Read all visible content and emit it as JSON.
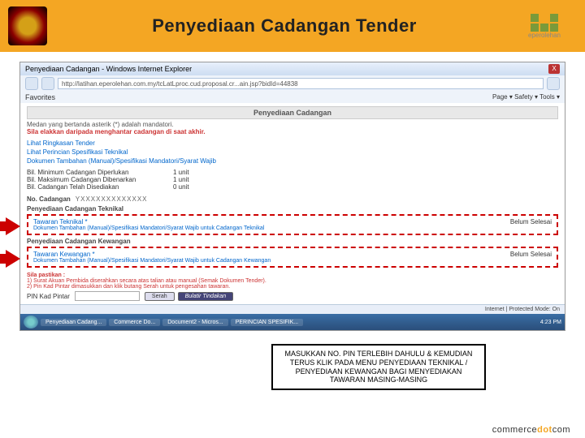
{
  "slide": {
    "title": "Penyediaan Cadangan Tender"
  },
  "logo_right_text": "eperolehan",
  "browser": {
    "window_title": "Penyediaan Cadangan - Windows Internet Explorer",
    "url": "http://latihan.eperolehan.com.my/tcLatLproc.cud.proposal.cr...ain.jsp?bidId=44838",
    "favorites_label": "Favorites",
    "toolbar_right": "Page ▾  Safety ▾  Tools ▾",
    "status_left": "",
    "status_right": "Internet | Protected Mode: On"
  },
  "page": {
    "title": "Penyediaan Cadangan",
    "mandatori": "Medan yang bertanda asterik (*) adalah mandatori.",
    "warning": "Sila elakkan daripada menghantar cadangan di saat akhir.",
    "links": [
      "Lihat Ringkasan Tender",
      "Lihat Perincian Spesifikasi Teknikal",
      "Dokumen Tambahan (Manual)/Spesifikasi Mandatori/Syarat Wajib"
    ],
    "counts": [
      {
        "label": "Bil. Minimum Cadangan Diperlukan",
        "val": "1 unit"
      },
      {
        "label": "Bil. Maksimum Cadangan Dibenarkan",
        "val": "1 unit"
      },
      {
        "label": "Bil. Cadangan Telah Disediakan",
        "val": "0 unit"
      }
    ],
    "no_cadangan": {
      "label": "No. Cadangan",
      "value": "YXXXXXXXXXXXXX"
    },
    "sections": [
      {
        "label": "Penyediaan Cadangan Teknikal",
        "link1": "Tawaran Teknikal *",
        "link2": "Dokumen Tambahan (Manual)/Spesifikasi Mandatori/Syarat Wajib untuk Cadangan Teknikal",
        "status": "Belum Selesai"
      },
      {
        "label": "Penyediaan Cadangan Kewangan",
        "link1": "Tawaran Kewangan *",
        "link2": "Dokumen Tambahan (Manual)/Spesifikasi Mandatori/Syarat Wajib untuk Cadangan Kewangan",
        "status": "Belum Selesai"
      }
    ],
    "sila": {
      "title": "Sila pastikan :",
      "item1": "1) Surat Akuan Pembida diserahkan secara atas talian atau manual (Semak Dokumen Tender).",
      "item2": "2) Pin Kad Pintar dimasukkan dan klik butang Serah untuk pengesahan tawaran."
    },
    "pin": {
      "label": "PIN Kad Pintar",
      "placeholder": ""
    },
    "buttons": {
      "serah": "Serah",
      "bulatir": "Bulatir Tindakan"
    }
  },
  "callout": {
    "text": "MASUKKAN NO. PIN TERLEBIH DAHULU & KEMUDIAN TERUS KLIK PADA MENU PENYEDIAAN TEKNIKAL / PENYEDIAAN KEWANGAN BAGI MENYEDIAKAN TAWARAN MASING-MASING"
  },
  "taskbar": {
    "items": [
      "Penyediaan Cadang...",
      "Commerce Do...",
      "Document2 - Micros...",
      "PERINCIAN SPESIFIK..."
    ],
    "time": "4:23 PM"
  },
  "footer_logo": {
    "pre": "commerce",
    "dot": "dot",
    "post": "com"
  }
}
